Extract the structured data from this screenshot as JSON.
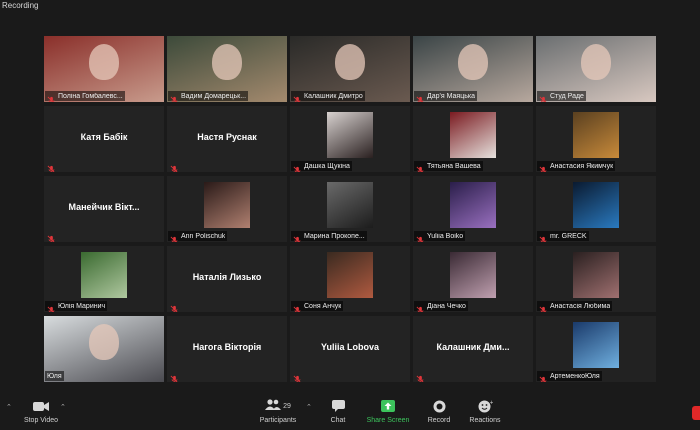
{
  "recording_label": "Recording",
  "participants": [
    {
      "name": "Поліна Гомбалевс...",
      "kind": "video",
      "bg": [
        "#8a2f2a",
        "#c89b8c"
      ]
    },
    {
      "name": "Вадим Домарецьк...",
      "kind": "video",
      "bg": [
        "#3c4a3a",
        "#a48a6e"
      ]
    },
    {
      "name": "Калашник Дмитро",
      "kind": "video",
      "bg": [
        "#2a2a28",
        "#6a5a50"
      ]
    },
    {
      "name": "Дар'я Маяцька",
      "kind": "video",
      "bg": [
        "#3a4446",
        "#b7a89e"
      ]
    },
    {
      "name": "Студ Раде",
      "kind": "video",
      "bg": [
        "#6a6e70",
        "#d8c8c0"
      ]
    },
    {
      "name": "Катя Бабік",
      "kind": "name"
    },
    {
      "name": "Настя Руснак",
      "kind": "name"
    },
    {
      "name": "Дашка Щукіна",
      "kind": "avatar",
      "bg": [
        "#d8d2d0",
        "#2a2020"
      ]
    },
    {
      "name": "Тятьяна Вашева",
      "kind": "avatar",
      "bg": [
        "#7a1a20",
        "#e6e2de"
      ]
    },
    {
      "name": "Анастасия Якимчук",
      "kind": "avatar",
      "bg": [
        "#5a4020",
        "#c88a3a"
      ]
    },
    {
      "name": "Манейчик Вікт...",
      "kind": "name"
    },
    {
      "name": "Ann Polischuk",
      "kind": "avatar",
      "bg": [
        "#2a1a18",
        "#b08070"
      ]
    },
    {
      "name": "Марина Прокопе...",
      "kind": "avatar",
      "bg": [
        "#6a6a6a",
        "#1c1c1c"
      ]
    },
    {
      "name": "Yuliia Boiko",
      "kind": "avatar",
      "bg": [
        "#2a1e4a",
        "#9a70c0"
      ]
    },
    {
      "name": "mr. GRECK",
      "kind": "avatar",
      "bg": [
        "#0a1a30",
        "#2a7ac0"
      ]
    },
    {
      "name": "Юлія Маринич",
      "kind": "avatar",
      "bg": [
        "#3a6a30",
        "#b0c8a0"
      ]
    },
    {
      "name": "Наталія Лизько",
      "kind": "name"
    },
    {
      "name": "Соня Анчук",
      "kind": "avatar",
      "bg": [
        "#3a2a20",
        "#b05a40"
      ]
    },
    {
      "name": "Діана Чечко",
      "kind": "avatar",
      "bg": [
        "#3a2a34",
        "#c0a0b0"
      ]
    },
    {
      "name": "Анастасія Любима",
      "kind": "avatar",
      "bg": [
        "#2a2020",
        "#a07070"
      ]
    },
    {
      "name": "Юля",
      "kind": "video",
      "active": true,
      "bg": [
        "#d8dcde",
        "#4a4a50"
      ]
    },
    {
      "name": "Нагога Вікторія",
      "kind": "name"
    },
    {
      "name": "Yuliia Lobova",
      "kind": "name"
    },
    {
      "name": "Калашник Дми...",
      "kind": "name"
    },
    {
      "name": "АртеменкоЮля",
      "kind": "avatar",
      "bg": [
        "#1a3a6a",
        "#70b0e0"
      ]
    }
  ],
  "toolbar": {
    "stop_video": "Stop Video",
    "participants": "Participants",
    "participants_count": "29",
    "chat": "Chat",
    "share_screen": "Share Screen",
    "record": "Record",
    "reactions": "Reactions"
  },
  "colors": {
    "background": "#1a1a1a",
    "tile": "#232323",
    "active_border": "#d9e85a",
    "muted_red": "#e0353a",
    "share_green": "#3cc35c"
  }
}
